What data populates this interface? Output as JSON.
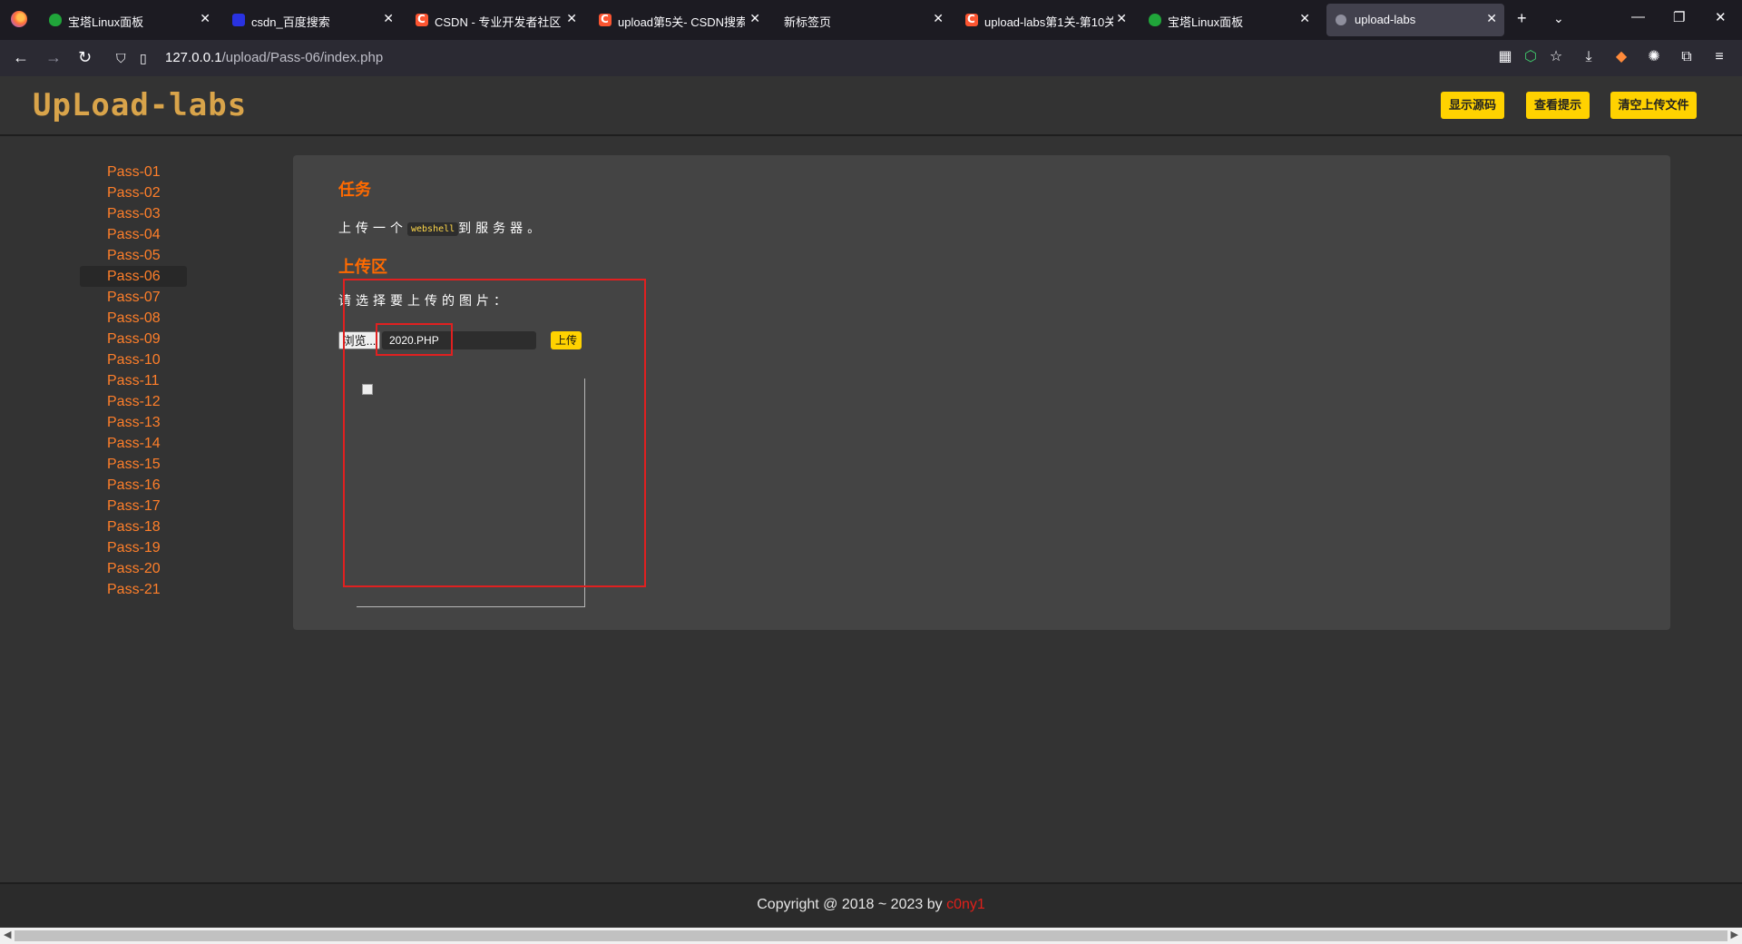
{
  "tabs": [
    {
      "label": "宝塔Linux面板",
      "icon": "bt-panel-icon"
    },
    {
      "label": "csdn_百度搜索",
      "icon": "baidu-icon"
    },
    {
      "label": "CSDN - 专业开发者社区",
      "icon": "csdn-icon"
    },
    {
      "label": "upload第5关- CSDN搜索",
      "icon": "csdn-icon"
    },
    {
      "label": "新标签页",
      "icon": ""
    },
    {
      "label": "upload-labs第1关-第10关",
      "icon": "csdn-icon"
    },
    {
      "label": "宝塔Linux面板",
      "icon": "bt-panel-icon"
    },
    {
      "label": "upload-labs",
      "icon": "github-icon"
    }
  ],
  "address": {
    "host": "127.0.0.1",
    "path": "/upload/Pass-06/index.php"
  },
  "header": {
    "logo": "UpLoad-labs",
    "buttons": [
      "显示源码",
      "查看提示",
      "清空上传文件"
    ]
  },
  "sidebar": {
    "items": [
      "Pass-01",
      "Pass-02",
      "Pass-03",
      "Pass-04",
      "Pass-05",
      "Pass-06",
      "Pass-07",
      "Pass-08",
      "Pass-09",
      "Pass-10",
      "Pass-11",
      "Pass-12",
      "Pass-13",
      "Pass-14",
      "Pass-15",
      "Pass-16",
      "Pass-17",
      "Pass-18",
      "Pass-19",
      "Pass-20",
      "Pass-21"
    ],
    "active": "Pass-06"
  },
  "main": {
    "task_title": "任务",
    "task_prefix": "上传一个",
    "task_code": "webshell",
    "task_suffix": "到服务器。",
    "upload_title": "上传区",
    "choose_label": "请选择要上传的图片：",
    "browse_label": "浏览...",
    "file_name": "2020.PHP",
    "upload_label": "上传"
  },
  "footer": {
    "copyright": "Copyright @ 2018 ~ 2023 by ",
    "author": "c0ny1"
  },
  "colors": {
    "accent": "#ff6a00",
    "button": "#ffd200",
    "annotation": "#e02020"
  }
}
